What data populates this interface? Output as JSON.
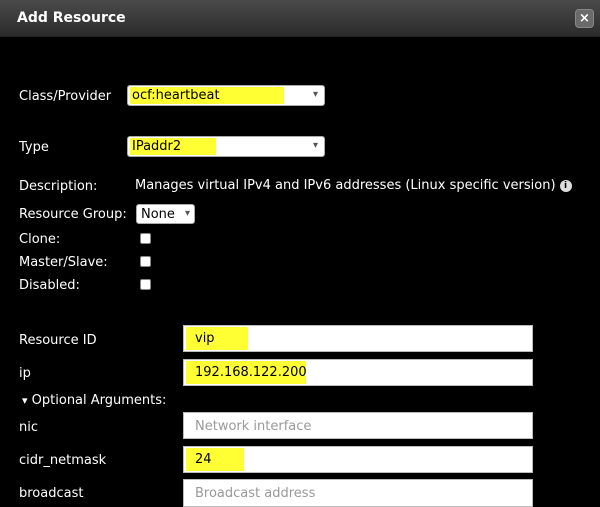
{
  "dialog": {
    "title": "Add Resource",
    "close_label": "×"
  },
  "form": {
    "class_provider": {
      "label": "Class/Provider",
      "value": "ocf:heartbeat"
    },
    "type": {
      "label": "Type",
      "value": "IPaddr2"
    },
    "description": {
      "label": "Description:",
      "value": "Manages virtual IPv4 and IPv6 addresses (Linux specific version)",
      "info_icon": "i"
    },
    "resource_group": {
      "label": "Resource Group:",
      "value": "None"
    },
    "clone": {
      "label": "Clone:"
    },
    "master_slave": {
      "label": "Master/Slave:"
    },
    "disabled": {
      "label": "Disabled:"
    },
    "resource_id": {
      "label": "Resource ID",
      "value": "vip"
    },
    "ip": {
      "label": "ip",
      "value": "192.168.122.200"
    },
    "optional_args": {
      "label": "Optional Arguments:"
    },
    "nic": {
      "label": "nic",
      "placeholder": "Network interface"
    },
    "cidr_netmask": {
      "label": "cidr_netmask",
      "value": "24"
    },
    "broadcast": {
      "label": "broadcast",
      "placeholder": "Broadcast address"
    }
  },
  "icons": {
    "dropdown": "▾",
    "expand": "▾",
    "close": "×"
  }
}
